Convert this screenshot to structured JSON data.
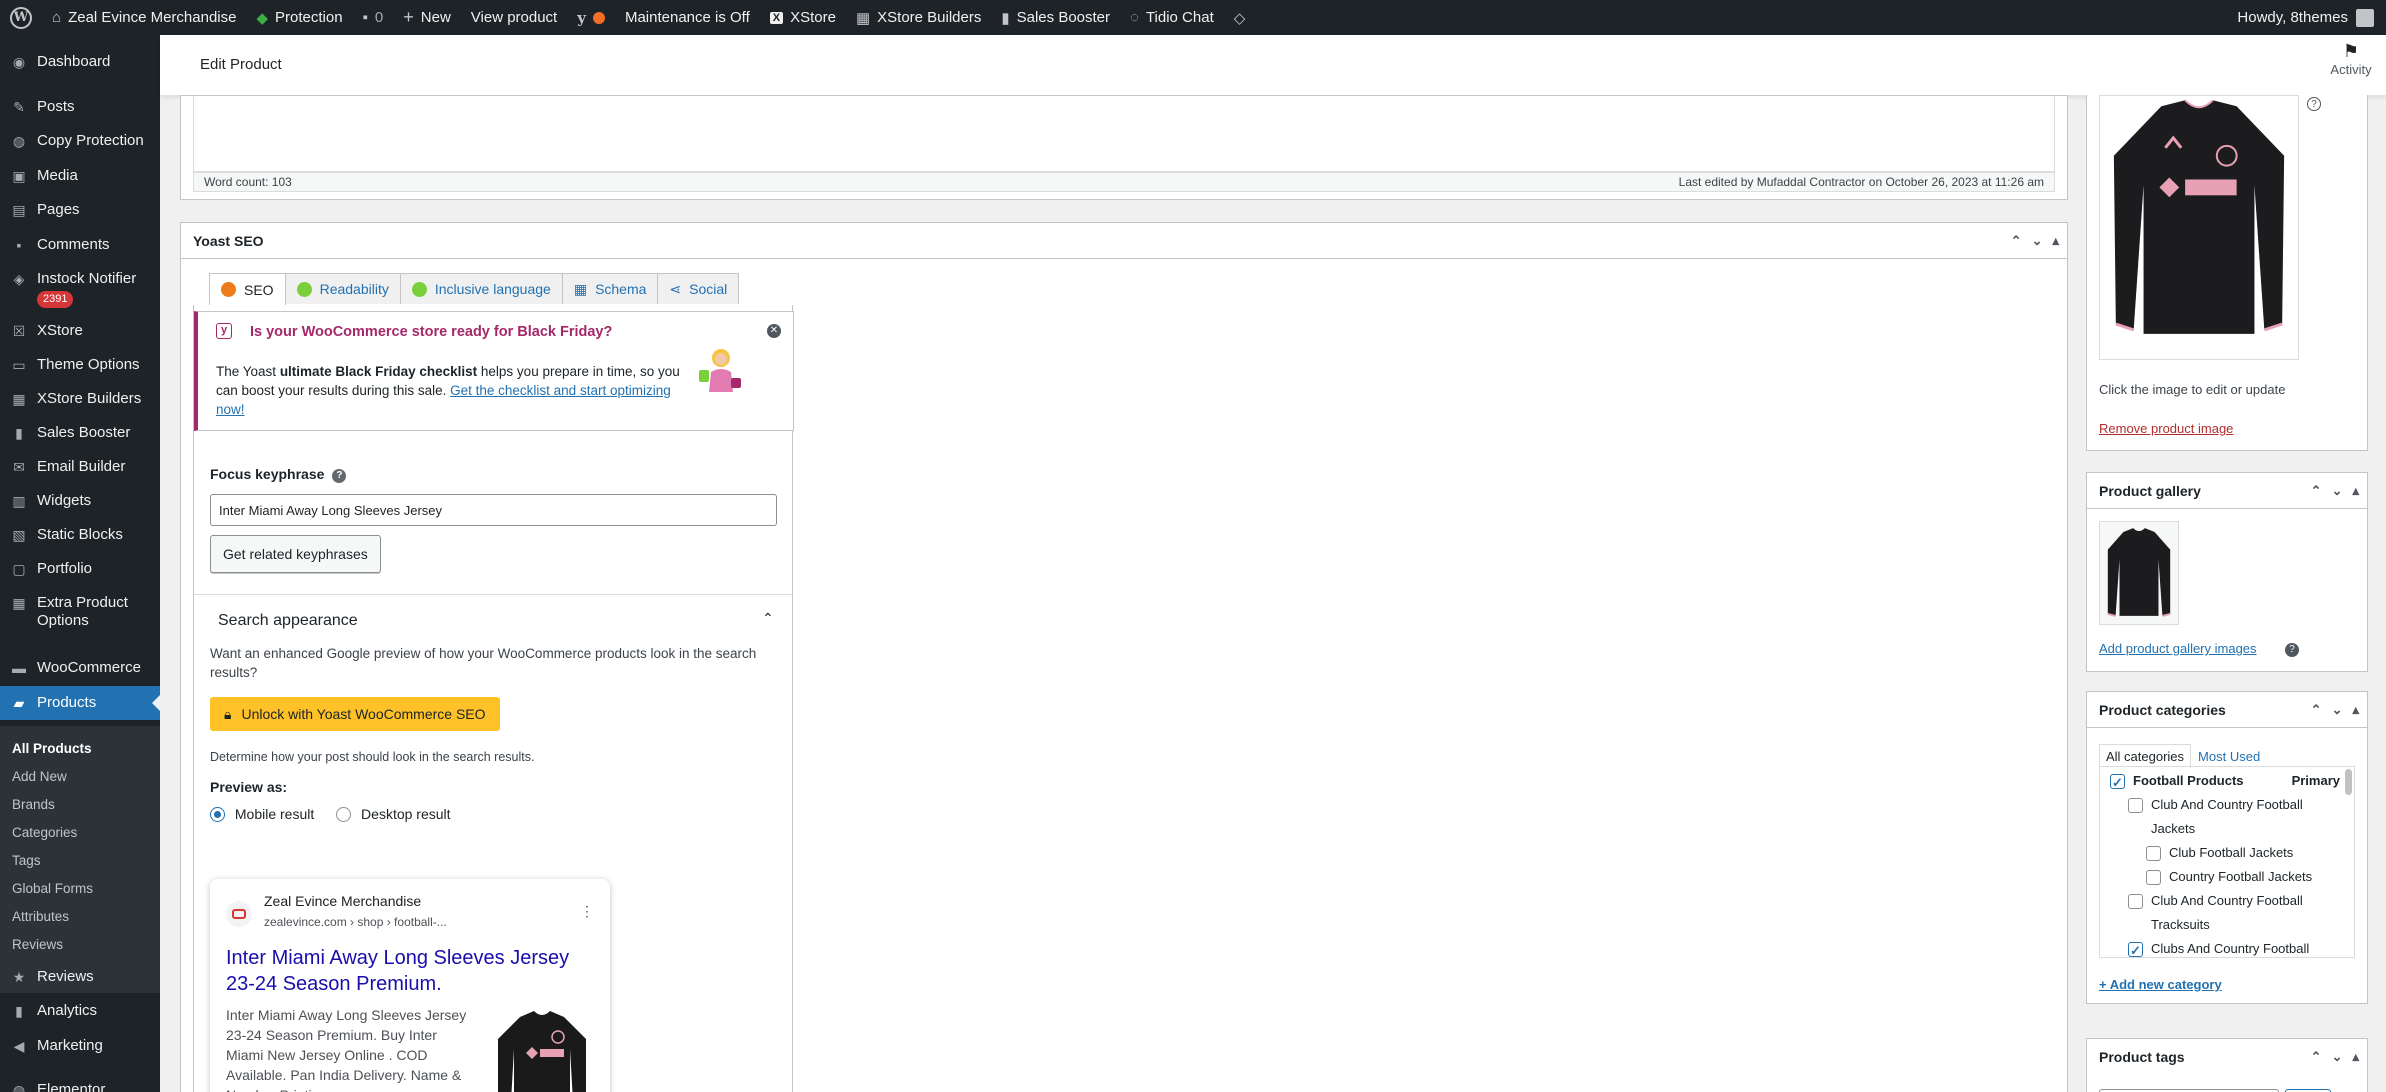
{
  "adminbar": {
    "site_name": "Zeal Evince Merchandise",
    "protection": "Protection",
    "comments_count": "0",
    "new_label": "New",
    "view_product": "View product",
    "maintenance": "Maintenance is Off",
    "xstore": "XStore",
    "xstore_builders": "XStore Builders",
    "sales_booster": "Sales Booster",
    "tidio": "Tidio Chat",
    "howdy": "Howdy, 8themes"
  },
  "sidebar": {
    "items": [
      {
        "label": "Dashboard"
      },
      {
        "label": "Posts"
      },
      {
        "label": "Copy Protection"
      },
      {
        "label": "Media"
      },
      {
        "label": "Pages"
      },
      {
        "label": "Comments"
      },
      {
        "label": "Instock Notifier",
        "badge": "2391"
      },
      {
        "label": "XStore"
      },
      {
        "label": "Theme Options"
      },
      {
        "label": "XStore Builders"
      },
      {
        "label": "Sales Booster"
      },
      {
        "label": "Email Builder"
      },
      {
        "label": "Widgets"
      },
      {
        "label": "Static Blocks"
      },
      {
        "label": "Portfolio"
      },
      {
        "label": "Extra Product Options"
      },
      {
        "label": "WooCommerce"
      },
      {
        "label": "Products"
      },
      {
        "label": "Reviews"
      },
      {
        "label": "Analytics"
      },
      {
        "label": "Marketing"
      },
      {
        "label": "Elementor"
      }
    ],
    "submenu": [
      "All Products",
      "Add New",
      "Brands",
      "Categories",
      "Tags",
      "Global Forms",
      "Attributes",
      "Reviews"
    ]
  },
  "header": {
    "title": "Edit Product",
    "activity": "Activity"
  },
  "editor": {
    "word_count": "Word count: 103",
    "last_edited": "Last edited by Mufaddal Contractor on October 26, 2023 at 11:26 am"
  },
  "yoast": {
    "title": "Yoast SEO",
    "tabs": [
      "SEO",
      "Readability",
      "Inclusive language",
      "Schema",
      "Social"
    ],
    "promo": {
      "title": "Is your WooCommerce store ready for Black Friday?",
      "body_pre": "The Yoast ",
      "body_bold": "ultimate Black Friday checklist",
      "body_mid": " helps you prepare in time, so you can boost your results during this sale. ",
      "body_link": "Get the checklist and start optimizing now!"
    },
    "focus_label": "Focus keyphrase",
    "focus_value": "Inter Miami Away Long Sleeves Jersey",
    "related_button": "Get related keyphrases",
    "search_appearance": "Search appearance",
    "enhanced_text": "Want an enhanced Google preview of how your WooCommerce products look in the search results?",
    "unlock_button": "Unlock with Yoast WooCommerce SEO",
    "determine_text": "Determine how your post should look in the search results.",
    "preview_as": "Preview as:",
    "mobile_result": "Mobile result",
    "desktop_result": "Desktop result",
    "google": {
      "site": "Zeal Evince Merchandise",
      "url": "zealevince.com › shop › football-...",
      "title": "Inter Miami Away Long Sleeves Jersey 23-24 Season Premium.",
      "desc": "Inter Miami Away Long Sleeves Jersey 23-24 Season Premium. Buy Inter Miami New Jersey Online . COD Available. Pan India Delivery. Name & Number Printing."
    }
  },
  "right": {
    "click_image": "Click the image to edit or update",
    "remove_image": "Remove product image",
    "gallery_title": "Product gallery",
    "add_gallery": "Add product gallery images",
    "categories_title": "Product categories",
    "cat_tab_all": "All categories",
    "cat_tab_used": "Most Used",
    "primary": "Primary",
    "categories": [
      "Football Products",
      "Club And Country Football Jackets",
      "Club Football Jackets",
      "Country Football Jackets",
      "Club And Country Football Tracksuits",
      "Clubs And Country Football"
    ],
    "add_category": "+ Add new category",
    "tags_title": "Product tags"
  },
  "colors": {
    "accent": "#2271b1",
    "yoast_purple": "#a4286a",
    "yellow": "#fec228"
  }
}
